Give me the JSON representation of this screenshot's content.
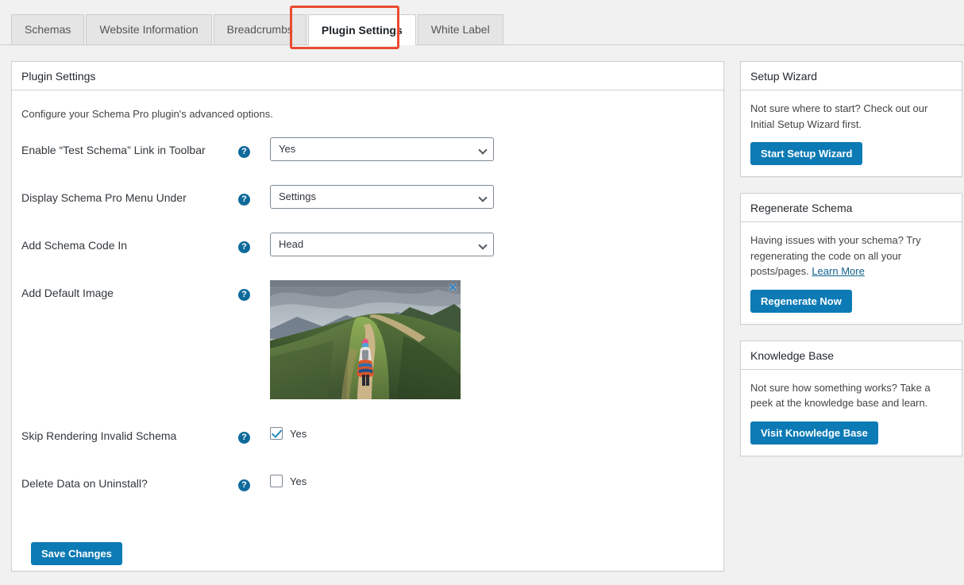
{
  "tabs": [
    {
      "label": "Schemas",
      "active": false
    },
    {
      "label": "Website Information",
      "active": false
    },
    {
      "label": "Breadcrumbs",
      "active": false
    },
    {
      "label": "Plugin Settings",
      "active": true
    },
    {
      "label": "White Label",
      "active": false
    }
  ],
  "main": {
    "panel_title": "Plugin Settings",
    "intro": "Configure your Schema Pro plugin's advanced options.",
    "help_icon": "question-mark-icon",
    "rows": [
      {
        "label": "Enable “Test Schema” Link in Toolbar",
        "type": "select",
        "value": "Yes"
      },
      {
        "label": "Display Schema Pro Menu Under",
        "type": "select",
        "value": "Settings"
      },
      {
        "label": "Add Schema Code In",
        "type": "select",
        "value": "Head"
      },
      {
        "label": "Add Default Image",
        "type": "image",
        "value": "mountain-trail-hiker-photo",
        "close_icon": "✕"
      },
      {
        "label": "Skip Rendering Invalid Schema",
        "type": "checkbox",
        "value": "Yes",
        "checked": true
      },
      {
        "label": "Delete Data on Uninstall?",
        "type": "checkbox",
        "value": "Yes",
        "checked": false
      }
    ],
    "save_label": "Save Changes"
  },
  "sidebar": {
    "cards": [
      {
        "title": "Setup Wizard",
        "text": "Not sure where to start? Check out our Initial Setup Wizard first.",
        "button": "Start Setup Wizard",
        "link": ""
      },
      {
        "title": "Regenerate Schema",
        "text": "Having issues with your schema? Try regenerating the code on all your posts/pages. ",
        "button": "Regenerate Now",
        "link": "Learn More"
      },
      {
        "title": "Knowledge Base",
        "text": "Not sure how something works? Take a peek at the knowledge base and learn.",
        "button": "Visit Knowledge Base",
        "link": ""
      }
    ]
  },
  "colors": {
    "accent": "#0c7ab5",
    "help": "#0f6a9c",
    "highlight": "#ec4a2f",
    "page_bg": "#f1f1f1"
  }
}
